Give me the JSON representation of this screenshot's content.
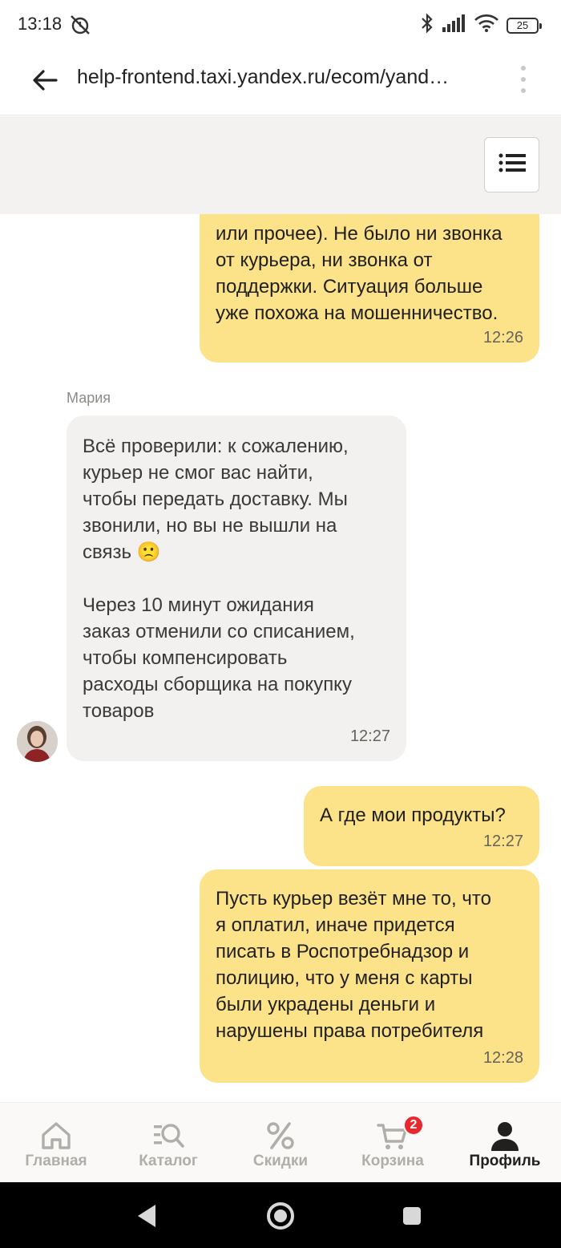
{
  "status_bar": {
    "time": "13:18",
    "battery": "25",
    "icons": [
      "alarm-off-icon",
      "bluetooth-icon",
      "signal-icon",
      "wifi-icon",
      "battery-icon"
    ]
  },
  "browser": {
    "url": "help-frontend.taxi.yandex.ru/ecom/yand…",
    "back_icon": "arrow-left-icon",
    "menu_icon": "kebab-menu-icon"
  },
  "header": {
    "menu_icon": "list-menu-icon"
  },
  "colors": {
    "outgoing_bubble": "#fce38a",
    "incoming_bubble": "#f2f1ef",
    "header_bg": "#f3f2f0",
    "badge": "#e9272f"
  },
  "messages": [
    {
      "direction": "out",
      "text": "или прочее). Не было ни звонка\nот курьера, ни звонка от\nподдержки. Ситуация больше\nуже похожа на мошенничество.",
      "time": "12:26"
    },
    {
      "direction": "in",
      "sender": "Мария",
      "text": "Всё проверили: к сожалению,\nкурьер не смог вас найти,\nчтобы передать доставку. Мы\nзвонили, но вы не вышли на\nсвязь 🙁\n\nЧерез 10 минут ожидания\nзаказ отменили со списанием,\nчтобы компенсировать\nрасходы сборщика на покупку\nтоваров",
      "time": "12:27"
    },
    {
      "direction": "out",
      "text": "А где мои продукты?",
      "time": "12:27"
    },
    {
      "direction": "out",
      "text": "Пусть курьер везёт мне то, что\nя оплатил, иначе придется\nписать в Роспотребнадзор и\nполицию, что у меня с карты\nбыли украдены деньги и\nнарушены права потребителя",
      "time": "12:28"
    }
  ],
  "bottom_nav": {
    "items": [
      {
        "label": "Главная",
        "icon": "home-icon"
      },
      {
        "label": "Каталог",
        "icon": "catalog-search-icon"
      },
      {
        "label": "Скидки",
        "icon": "percent-icon"
      },
      {
        "label": "Корзина",
        "icon": "cart-icon",
        "badge": "2"
      },
      {
        "label": "Профиль",
        "icon": "profile-icon",
        "active": true
      }
    ]
  },
  "android_nav": {
    "icons": [
      "back-triangle-icon",
      "home-circle-icon",
      "recents-square-icon"
    ]
  }
}
